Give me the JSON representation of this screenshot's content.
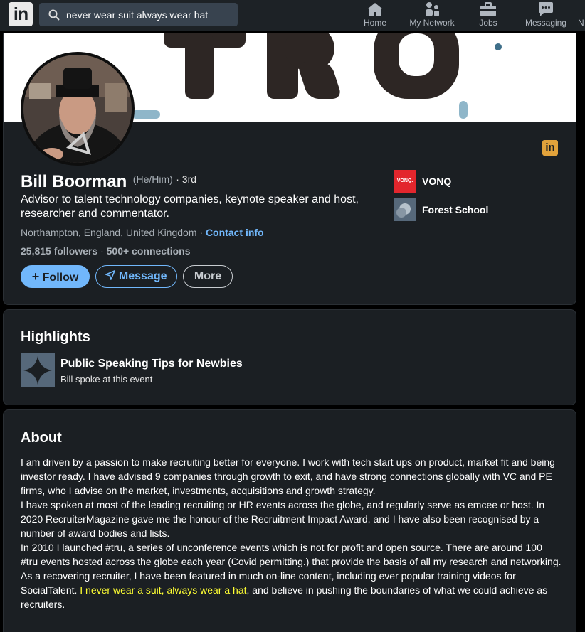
{
  "nav": {
    "search_value": "never wear suit always wear hat",
    "items": [
      {
        "label": "Home",
        "icon": "home-icon"
      },
      {
        "label": "My Network",
        "icon": "network-icon"
      },
      {
        "label": "Jobs",
        "icon": "briefcase-icon"
      },
      {
        "label": "Messaging",
        "icon": "messaging-icon"
      },
      {
        "label": "N",
        "icon": "notifications-icon"
      }
    ]
  },
  "profile": {
    "name": "Bill Boorman",
    "pronouns": "(He/Him)",
    "degree": "· 3rd",
    "headline": "Advisor to talent technology companies, keynote speaker and host, researcher and commentator.",
    "location": "Northampton, England, United Kingdom",
    "location_sep": "·",
    "contact_info": "Contact info",
    "followers": "25,815 followers",
    "connections": "500+ connections",
    "follow_label": "Follow",
    "message_label": "Message",
    "more_label": "More",
    "orgs": [
      {
        "name": "VONQ",
        "logo_text": "VONQ.",
        "color": "#e3262d"
      },
      {
        "name": "Forest School",
        "color": "#56687a"
      }
    ]
  },
  "highlights": {
    "title": "Highlights",
    "item_title": "Public Speaking Tips for Newbies",
    "item_subtitle": "Bill spoke at this event"
  },
  "about": {
    "title": "About",
    "p1": "I am driven by a passion to make recruiting better for everyone. I work with tech start ups on product, market fit and being investor ready. I have advised 9 companies through growth to exit, and have strong connections globally with VC and PE firms, who I advise on the market, investments, acquisitions and growth strategy.",
    "p2": "I have spoken at most of the leading recruiting or HR events across the globe, and regularly serve as emcee or host. In 2020 RecruiterMagazine gave me the honour of the Recruitment Impact Award, and I have also been recognised by a number of award bodies and lists.",
    "p3": "In 2010 I launched #tru, a series of unconference events which is not for profit and open source. There are around 100 #tru events hosted across the globe each year (Covid permitting.) that provide the basis of all my research and networking.",
    "p4_a": "As a recovering recruiter, I have been featured in much on-line content, including ever popular training videos for SocialTalent.",
    "p4_highlight": " I never wear a suit, always wear a hat",
    "p4_b": ", and believe in pushing the boundaries of what we could achieve as recruiters."
  }
}
